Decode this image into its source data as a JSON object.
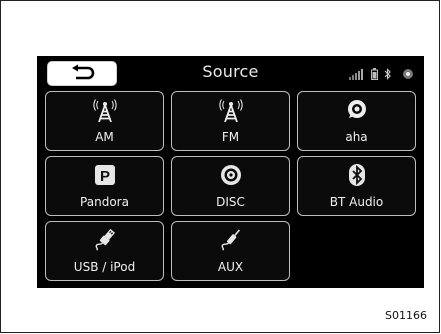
{
  "header": {
    "title": "Source"
  },
  "sources": [
    {
      "label": "AM",
      "icon": "antenna-icon"
    },
    {
      "label": "FM",
      "icon": "antenna-icon"
    },
    {
      "label": "aha",
      "icon": "aha-icon"
    },
    {
      "label": "Pandora",
      "icon": "pandora-icon"
    },
    {
      "label": "DISC",
      "icon": "disc-icon"
    },
    {
      "label": "BT Audio",
      "icon": "bluetooth-icon"
    },
    {
      "label": "USB / iPod",
      "icon": "usb-icon"
    },
    {
      "label": "AUX",
      "icon": "aux-plug-icon"
    }
  ],
  "figure_code": "S01166",
  "colors": {
    "screen_bg": "#000000",
    "tile_border": "#bdbdbd",
    "text": "#f1f1f1"
  }
}
